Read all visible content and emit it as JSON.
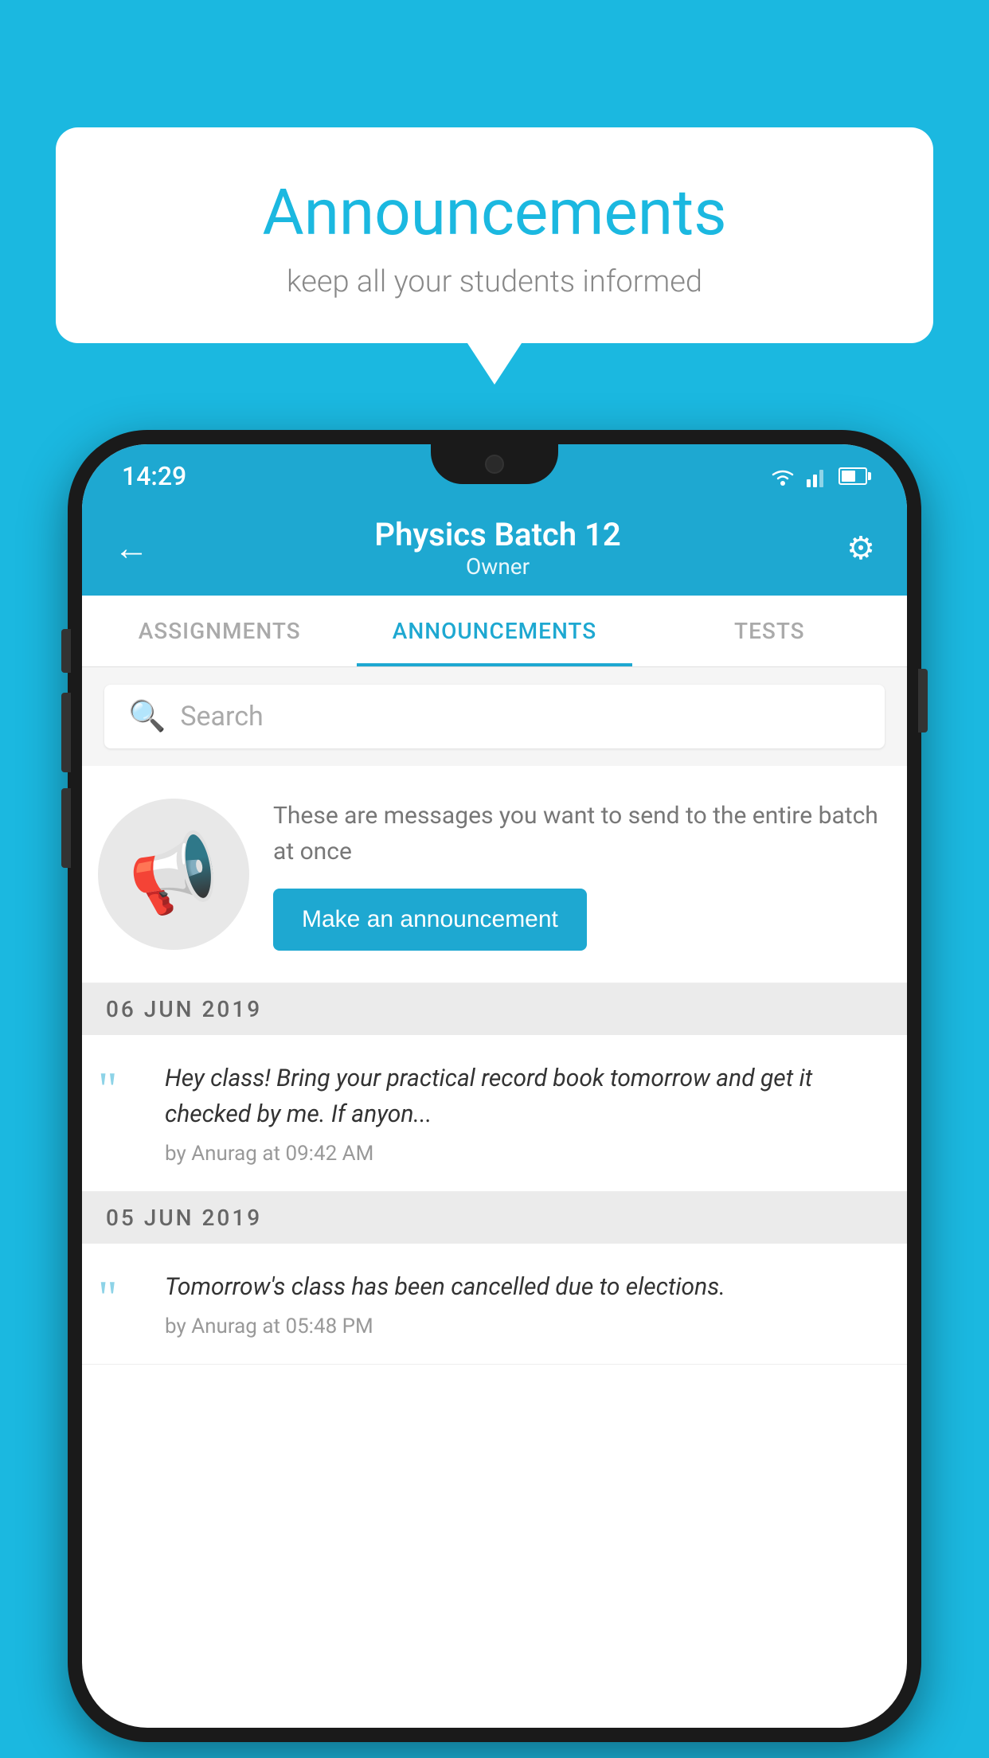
{
  "background_color": "#1BB8E0",
  "speech_bubble": {
    "title": "Announcements",
    "subtitle": "keep all your students informed"
  },
  "phone": {
    "status_bar": {
      "time": "14:29",
      "icons": [
        "wifi",
        "signal",
        "battery"
      ]
    },
    "app_bar": {
      "title": "Physics Batch 12",
      "subtitle": "Owner",
      "back_label": "←",
      "settings_label": "⚙"
    },
    "tabs": [
      {
        "label": "ASSIGNMENTS",
        "active": false
      },
      {
        "label": "ANNOUNCEMENTS",
        "active": true
      },
      {
        "label": "TESTS",
        "active": false
      }
    ],
    "search": {
      "placeholder": "Search"
    },
    "promo": {
      "description": "These are messages you want to send to the entire batch at once",
      "button_label": "Make an announcement"
    },
    "announcements": [
      {
        "date": "06  JUN  2019",
        "message": "Hey class! Bring your practical record book tomorrow and get it checked by me. If anyon...",
        "author": "by Anurag at 09:42 AM"
      },
      {
        "date": "05  JUN  2019",
        "message": "Tomorrow's class has been cancelled due to elections.",
        "author": "by Anurag at 05:48 PM"
      }
    ]
  }
}
